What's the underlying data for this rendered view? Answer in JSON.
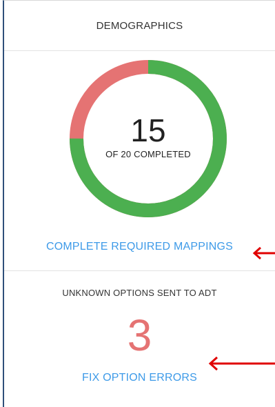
{
  "panel": {
    "title": "DEMOGRAPHICS"
  },
  "progress": {
    "completed": 15,
    "total": 20,
    "big_number": "15",
    "subtitle": "OF 20 COMPLETED",
    "complete_color": "#4caf50",
    "remaining_color": "#e57373"
  },
  "links": {
    "mappings": "COMPLETE REQUIRED MAPPINGS",
    "fix_errors": "FIX OPTION ERRORS"
  },
  "unknown_options": {
    "label": "UNKNOWN OPTIONS SENT TO ADT",
    "count": "3",
    "count_color": "#e57373"
  },
  "annotations": {
    "arrow_color": "#e00000",
    "icons": [
      "left-arrow-annotation",
      "left-arrow-annotation"
    ]
  }
}
